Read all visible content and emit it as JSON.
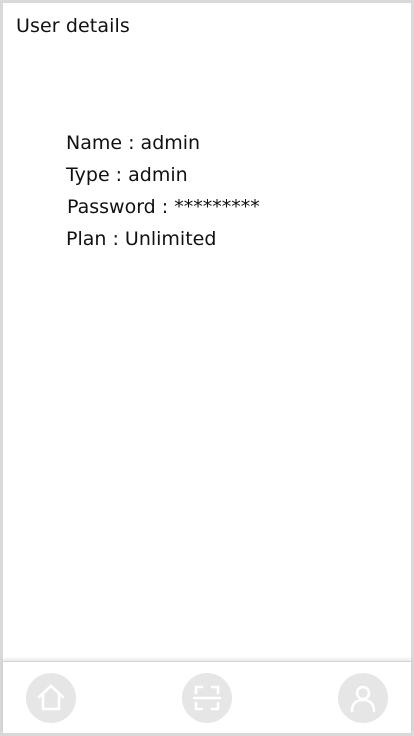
{
  "header": {
    "title": "User details"
  },
  "details": {
    "name": {
      "label": "Name",
      "value": "admin"
    },
    "type": {
      "label": "Type",
      "value": "admin"
    },
    "password": {
      "label": "Password",
      "value": "*********"
    },
    "plan": {
      "label": "Plan",
      "value": "Unlimited"
    },
    "separator": " : "
  },
  "nav": {
    "items": [
      {
        "icon": "home-icon"
      },
      {
        "icon": "scan-icon"
      },
      {
        "icon": "user-profile-icon"
      }
    ]
  },
  "colors": {
    "nav_button_bg": "#e6e6e6",
    "nav_icon": "#ffffff",
    "frame_border": "#d9d9d9"
  }
}
